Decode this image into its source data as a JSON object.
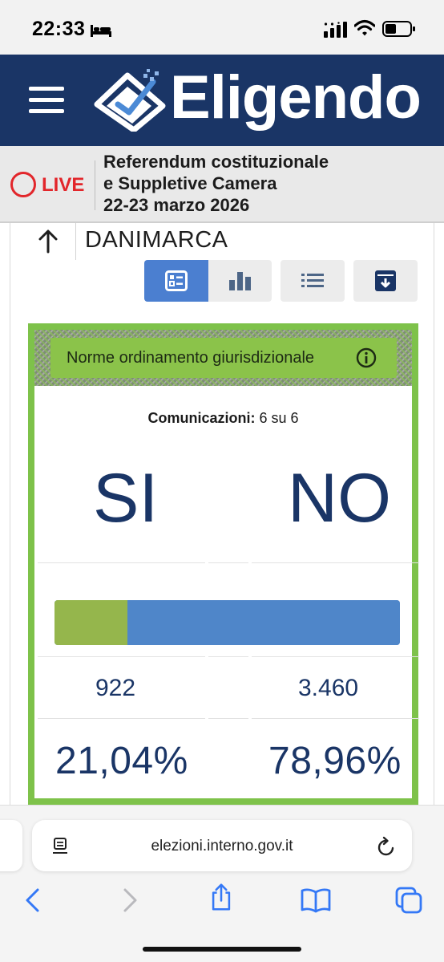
{
  "status_bar": {
    "time": "22:33",
    "icons": [
      "bed-icon",
      "cellular-signal-icon",
      "wifi-icon",
      "battery-icon"
    ]
  },
  "header": {
    "brand": "Eligendo",
    "menu_icon": "hamburger-menu-icon",
    "logo_icon": "ballot-check-logo-icon",
    "background_color": "#1a3566"
  },
  "live_banner": {
    "live_label": "LIVE",
    "title_lines": [
      "Referendum costituzionale",
      "e Suppletive Camera",
      "22-23 marzo 2026"
    ],
    "live_color": "#e2262b"
  },
  "location": {
    "back_icon": "arrow-up-icon",
    "country": "DANIMARCA"
  },
  "view_tabs": [
    {
      "icon": "summary-card-icon",
      "active": true
    },
    {
      "icon": "bar-chart-icon",
      "active": false
    },
    {
      "icon": "list-icon",
      "active": false
    },
    {
      "icon": "archive-download-icon",
      "active": false
    }
  ],
  "result": {
    "question": "Norme ordinamento giurisdizionale",
    "info_icon": "info-icon",
    "communications_label": "Comunicazioni:",
    "communications_value": "6 su 6",
    "yes_label": "SI",
    "no_label": "NO",
    "yes_votes": "922",
    "no_votes": "3.460",
    "yes_percent": "21,04%",
    "no_percent": "78,96%",
    "yes_share": 0.2104,
    "no_share": 0.7896,
    "yes_color": "#95b64c",
    "no_color": "#4f86c9",
    "border_color": "#7ec24a"
  },
  "browser": {
    "url": "elezioni.interno.gov.it",
    "page_icon": "page-format-icon",
    "reload_icon": "reload-icon",
    "toolbar_icons": [
      "back-chevron-icon",
      "forward-chevron-icon",
      "share-icon",
      "bookmarks-book-icon",
      "tabs-icon"
    ]
  }
}
